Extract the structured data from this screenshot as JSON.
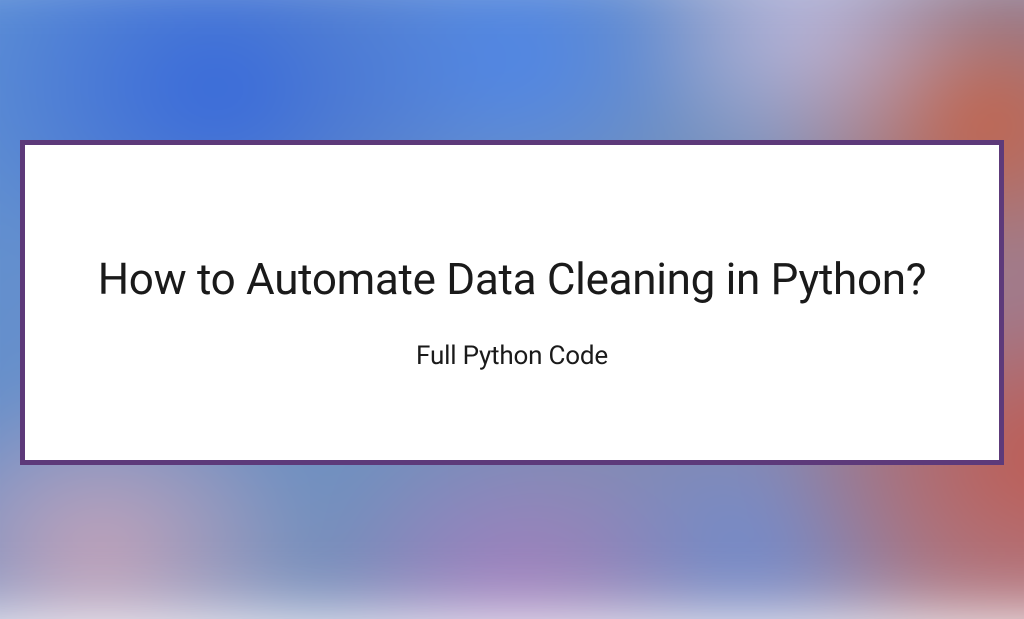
{
  "card": {
    "title": "How to Automate Data Cleaning in Python?",
    "subtitle": "Full Python Code"
  },
  "colors": {
    "card_border": "#5d3a7a",
    "card_background": "#ffffff",
    "text": "#1a1a1a"
  }
}
